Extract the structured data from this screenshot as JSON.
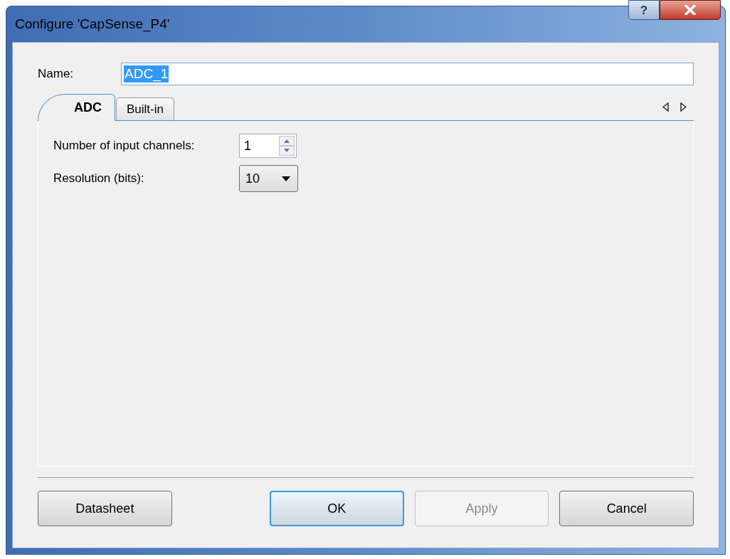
{
  "window": {
    "title": "Configure 'CapSense_P4'",
    "help_button": "?"
  },
  "name_field": {
    "label": "Name:",
    "value": "ADC_1",
    "highlighted": true
  },
  "tabs": [
    {
      "label": "ADC",
      "selected": true
    },
    {
      "label": "Built-in",
      "selected": false
    }
  ],
  "fields": [
    {
      "kind": "spinner",
      "label": "Number of input channels:",
      "value": "1"
    },
    {
      "kind": "dropdown",
      "label": "Resolution (bits):",
      "value": "10"
    }
  ],
  "buttons": [
    {
      "label": "Datasheet",
      "default": false,
      "disabled": false
    },
    {
      "label": "OK",
      "default": true,
      "disabled": false
    },
    {
      "label": "Apply",
      "default": false,
      "disabled": true
    },
    {
      "label": "Cancel",
      "default": false,
      "disabled": false
    }
  ]
}
